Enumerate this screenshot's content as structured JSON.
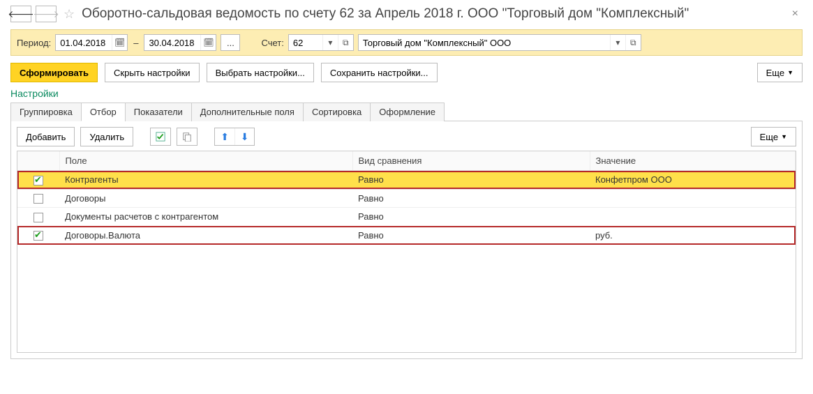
{
  "header": {
    "title": "Оборотно-сальдовая ведомость по счету 62 за Апрель 2018 г. ООО \"Торговый дом \"Комплексный\""
  },
  "period": {
    "label": "Период:",
    "from": "01.04.2018",
    "to": "30.04.2018",
    "account_label": "Счет:",
    "account_value": "62",
    "org_value": "Торговый дом \"Комплексный\" ООО"
  },
  "actions": {
    "run": "Сформировать",
    "hide_settings": "Скрыть настройки",
    "choose_settings": "Выбрать настройки...",
    "save_settings": "Сохранить настройки...",
    "more": "Еще"
  },
  "section_title": "Настройки",
  "tabs": {
    "grouping": "Группировка",
    "filter": "Отбор",
    "indicators": "Показатели",
    "extra_fields": "Дополнительные поля",
    "sorting": "Сортировка",
    "design": "Оформление"
  },
  "toolbar": {
    "add": "Добавить",
    "delete": "Удалить",
    "more": "Еще"
  },
  "columns": {
    "field": "Поле",
    "comparison": "Вид сравнения",
    "value": "Значение"
  },
  "rows": [
    {
      "checked": true,
      "selected": true,
      "highlight": true,
      "field": "Контрагенты",
      "comparison": "Равно",
      "value": "Конфетпром ООО"
    },
    {
      "checked": false,
      "selected": false,
      "highlight": false,
      "field": "Договоры",
      "comparison": "Равно",
      "value": ""
    },
    {
      "checked": false,
      "selected": false,
      "highlight": false,
      "field": "Документы расчетов с контрагентом",
      "comparison": "Равно",
      "value": ""
    },
    {
      "checked": true,
      "selected": false,
      "highlight": true,
      "field": "Договоры.Валюта",
      "comparison": "Равно",
      "value": "руб."
    }
  ]
}
